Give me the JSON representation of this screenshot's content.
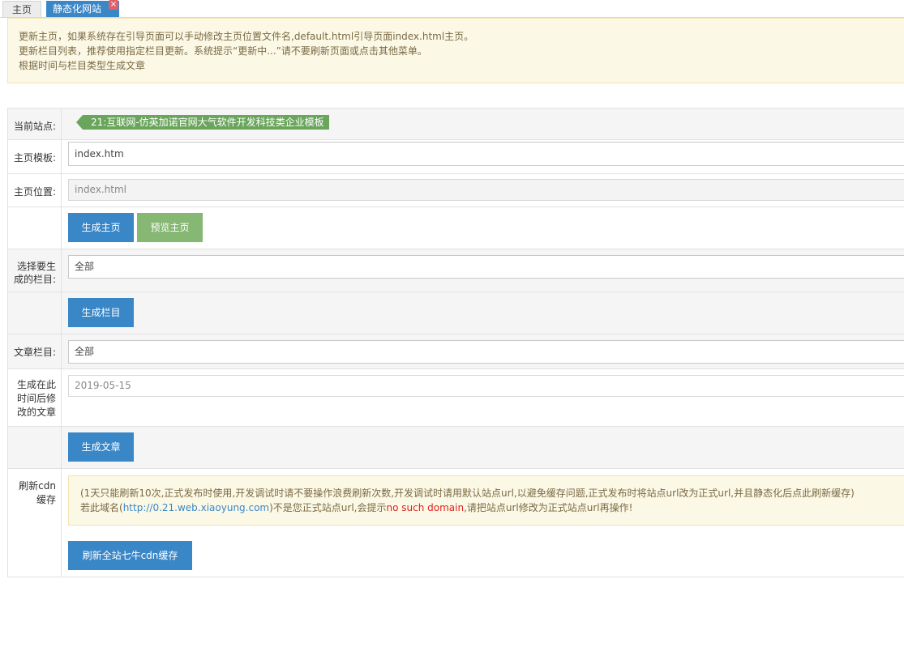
{
  "tabs": {
    "home": "主页",
    "static": "静态化网站",
    "close": "×"
  },
  "notice": {
    "line1": "更新主页，如果系统存在引导页面可以手动修改主页位置文件名,default.html引导页面index.html主页。",
    "line2": "更新栏目列表，推荐使用指定栏目更新。系统提示“更新中...”请不要刷新页面或点击其他菜单。",
    "line3": "根据时间与栏目类型生成文章"
  },
  "form": {
    "site_label": "当前站点:",
    "site_value": "21:互联网-仿英加诺官网大气软件开发科技类企业模板",
    "template_label": "主页模板:",
    "template_value": "index.htm",
    "location_label": "主页位置:",
    "location_value": "index.html",
    "gen_home_btn": "生成主页",
    "preview_home_btn": "预览主页",
    "column_label_1": "选择要生",
    "column_label_2": "成的栏目:",
    "column_value": "全部",
    "gen_column_btn": "生成栏目",
    "article_label": "文章栏目:",
    "article_value": "全部",
    "time_label_1": "生成在此",
    "time_label_2": "时间后修",
    "time_label_3": "改的文章",
    "time_value": "2019-05-15",
    "gen_article_btn": "生成文章",
    "cdn_label_1": "刷新cdn",
    "cdn_label_2": "缓存",
    "cdn_note_line1": "(1天只能刷新10次,正式发布时使用,开发调试时请不要操作浪费刷新次数,开发调试时请用默认站点url,以避免缓存问题,正式发布时将站点url改为正式url,并且静态化后点此刷新缓存)",
    "cdn_note_prefix": "若此域名(",
    "cdn_note_link": "http://0.21.web.xiaoyung.com",
    "cdn_note_mid": ")不是您正式站点url,会提示",
    "cdn_note_error": "no such domain",
    "cdn_note_suffix": ",请把站点url修改为正式站点url再操作!",
    "cdn_btn": "刷新全站七牛cdn缓存"
  },
  "colors": {
    "accent_blue": "#3a87c8",
    "accent_green": "#86b874",
    "site_tag_green": "#6aa55c",
    "notice_bg": "#fcf8e6",
    "error_red": "#e02020"
  }
}
